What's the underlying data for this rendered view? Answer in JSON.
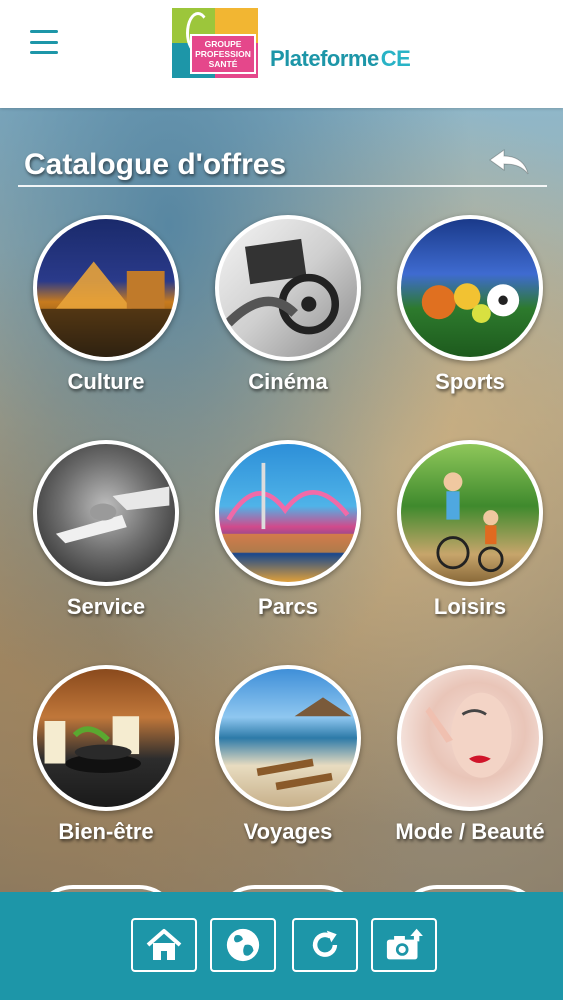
{
  "header": {
    "menu_icon": "hamburger-icon",
    "logo": {
      "lines": [
        "GROUPE",
        "PROFESSION",
        "SANTÉ"
      ]
    },
    "brand_name": "Plateforme",
    "brand_suffix": "CE",
    "colors": {
      "accent": "#1d96a8",
      "logo_pink": "#e5478b",
      "logo_green": "#9cc63b",
      "logo_yellow": "#f2b632"
    }
  },
  "catalog": {
    "title": "Catalogue d'offres",
    "back_icon": "back-arrow-icon",
    "categories": [
      {
        "label": "Culture",
        "image": "louvre-pyramid-night"
      },
      {
        "label": "Cinéma",
        "image": "film-clapper-reels"
      },
      {
        "label": "Sports",
        "image": "balls-in-stadium"
      },
      {
        "label": "Service",
        "image": "hand-ringing-desk-bell"
      },
      {
        "label": "Parcs",
        "image": "amusement-park-rides"
      },
      {
        "label": "Loisirs",
        "image": "family-cycling"
      },
      {
        "label": "Bien-être",
        "image": "spa-candles-stones"
      },
      {
        "label": "Voyages",
        "image": "tropical-beach-loungers"
      },
      {
        "label": "Mode / Beauté",
        "image": "woman-makeup-portrait"
      }
    ]
  },
  "footer": {
    "buttons": [
      {
        "icon": "home-icon"
      },
      {
        "icon": "globe-icon"
      },
      {
        "icon": "refresh-icon"
      },
      {
        "icon": "camera-upload-icon"
      }
    ]
  }
}
